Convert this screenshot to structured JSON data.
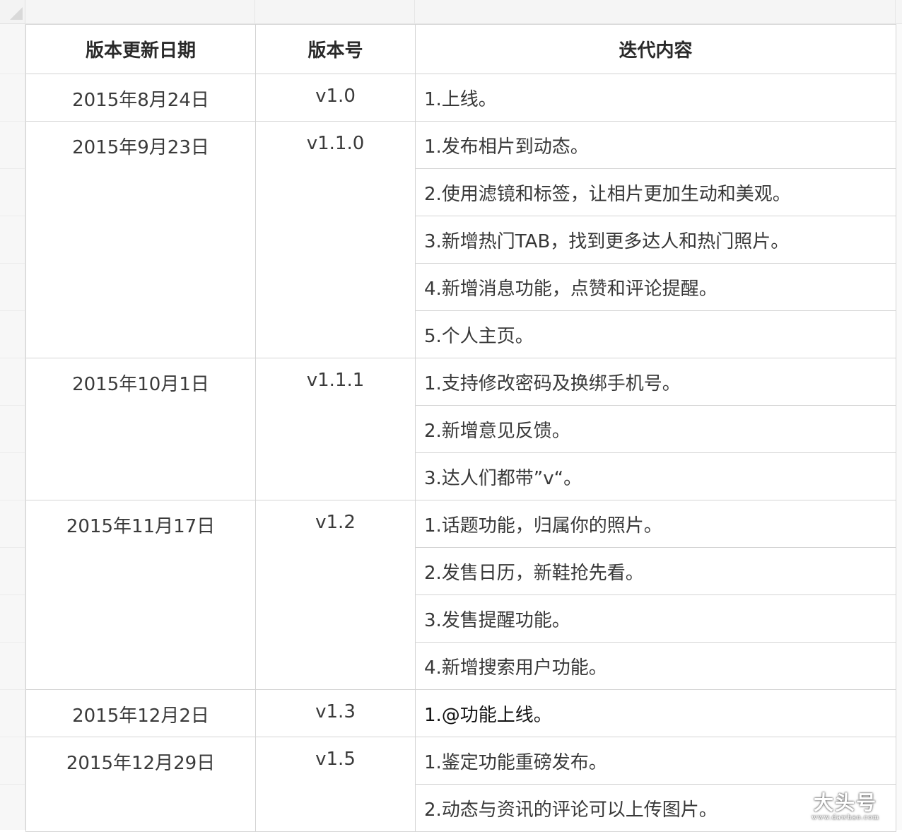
{
  "table": {
    "headers": {
      "date": "版本更新日期",
      "version": "版本号",
      "content": "迭代内容"
    },
    "releases": [
      {
        "date": "2015年8月24日",
        "version": "v1.0",
        "items": [
          "1.上线。"
        ]
      },
      {
        "date": "2015年9月23日",
        "version": "v1.1.0",
        "items": [
          "1.发布相片到动态。",
          "2.使用滤镜和标签，让相片更加生动和美观。",
          "3.新增热门TAB，找到更多达人和热门照片。",
          "4.新增消息功能，点赞和评论提醒。",
          "5.个人主页。"
        ]
      },
      {
        "date": "2015年10月1日",
        "version": "v1.1.1",
        "items": [
          "1.支持修改密码及换绑手机号。",
          "2.新增意见反馈。",
          "3.达人们都带”v“。"
        ]
      },
      {
        "date": "2015年11月17日",
        "version": "v1.2",
        "items": [
          "1.话题功能，归属你的照片。",
          "2.发售日历，新鞋抢先看。",
          "3.发售提醒功能。",
          "4.新增搜索用户功能。"
        ]
      },
      {
        "date": "2015年12月2日",
        "version": "v1.3",
        "items": [
          "1.@功能上线。"
        ]
      },
      {
        "date": "2015年12月29日",
        "version": "v1.5",
        "items": [
          "1.鉴定功能重磅发布。",
          "2.动态与资讯的评论可以上传图片。"
        ]
      }
    ]
  },
  "watermark": {
    "main": "大头号",
    "sub": "www.dawhao.com"
  }
}
